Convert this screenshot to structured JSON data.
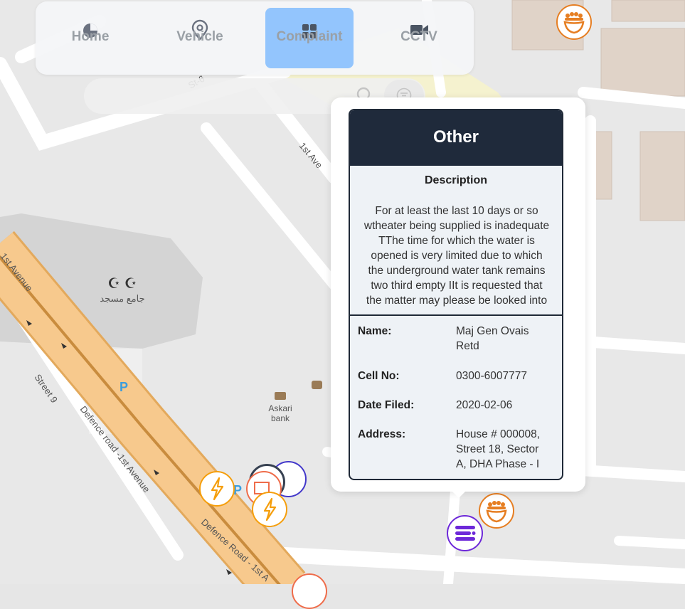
{
  "nav": {
    "items": [
      {
        "label": "Home",
        "icon": "pie-chart-icon",
        "active": false
      },
      {
        "label": "Vehicle",
        "icon": "map-pin-icon",
        "active": false
      },
      {
        "label": "Complaint",
        "icon": "grid-icon",
        "active": true
      },
      {
        "label": "CCTV",
        "icon": "video-camera-icon",
        "active": false
      }
    ]
  },
  "search": {
    "placeholder": "",
    "icon": "search-icon",
    "filter_icon": "filter-icon"
  },
  "map_labels": {
    "street_6": "St-6",
    "first_ave": "1st Ave",
    "first_avenue": "1st Avenue",
    "street_9": "Street 9",
    "defence_road_1": "Defence road -1st Avenue",
    "defence_road_2": "Defence Road - 1st A",
    "mosque": "جامع مسجد",
    "bank_line1": "Askari",
    "bank_line2": "bank",
    "parking_1": "P",
    "parking_2": "P"
  },
  "popup": {
    "title": "Other",
    "description_heading": "Description",
    "description_lines": [
      "For at least the last 10 days or so",
      "wtheater being supplied is inadequate",
      "TThe time for which the water is",
      "opened is very limited due to which",
      "the underground water tank remains",
      "two third empty IIt is requested that",
      "the matter may please be looked into"
    ],
    "fields": [
      {
        "label": "Name:",
        "value_lines": [
          "Maj Gen Ovais",
          "Retd"
        ]
      },
      {
        "label": "Cell No:",
        "value_lines": [
          "0300-6007777"
        ]
      },
      {
        "label": "Date Filed:",
        "value_lines": [
          "2020-02-06"
        ]
      },
      {
        "label": "Address:",
        "value_lines": [
          "House # 000008,",
          "Street 18, Sector",
          "A, DHA Phase - I"
        ]
      }
    ]
  },
  "colors": {
    "accent": "#93c5fd",
    "card_header": "#1f2a3b",
    "electric_marker": "#f59e0b",
    "crowd_marker": "#e67e22",
    "other_marker": "#6d28d9",
    "road_major": "#f7c98d"
  },
  "markers": [
    {
      "type": "crowd",
      "icon": "crowd-icon"
    },
    {
      "type": "crowd",
      "icon": "crowd-icon"
    },
    {
      "type": "other",
      "icon": "list-icon"
    },
    {
      "type": "electricity",
      "icon": "lightning-icon"
    },
    {
      "type": "electricity",
      "icon": "lightning-icon"
    },
    {
      "type": "cluster",
      "icon": "stacked-markers-icon"
    }
  ]
}
